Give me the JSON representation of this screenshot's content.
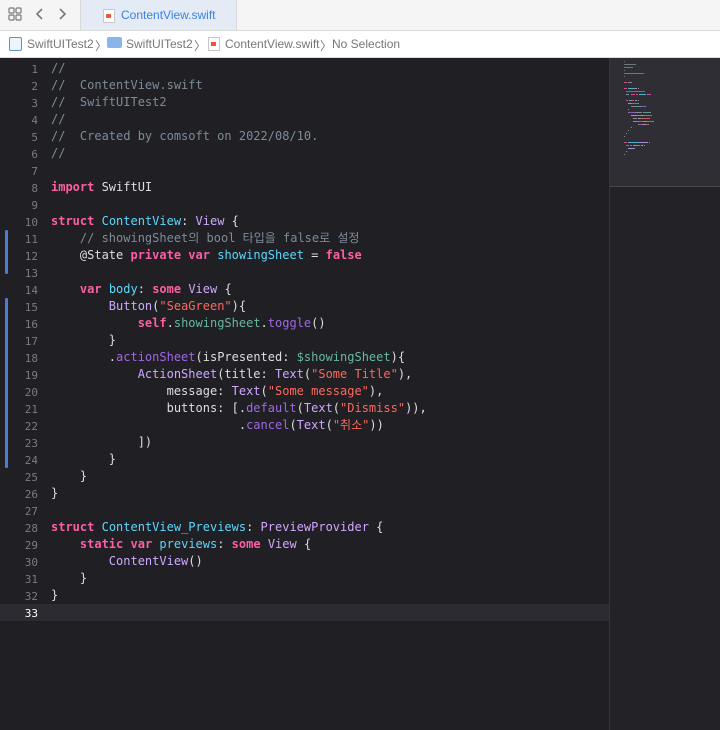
{
  "tabbar": {
    "active_tab": "ContentView.swift",
    "grid_icon": "grid-icon",
    "back_icon": "chevron-left-icon",
    "forward_icon": "chevron-right-icon"
  },
  "jumpbar": {
    "project": "SwiftUITest2",
    "group": "SwiftUITest2",
    "file": "ContentView.swift",
    "selection": "No Selection"
  },
  "colors": {
    "keyword": "#fc5fa3",
    "string": "#fc6a5d",
    "comment": "#7e8c98",
    "type": "#d0a8ff",
    "declaration": "#5dd8ff",
    "function": "#a167e6",
    "change_bar": "#4b7bd4"
  },
  "editor": {
    "current_line": 33,
    "lines": [
      [
        {
          "t": "//",
          "c": "cmt"
        }
      ],
      [
        {
          "t": "//  ContentView.swift",
          "c": "cmt"
        }
      ],
      [
        {
          "t": "//  SwiftUITest2",
          "c": "cmt"
        }
      ],
      [
        {
          "t": "//",
          "c": "cmt"
        }
      ],
      [
        {
          "t": "//  Created by comsoft on 2022/08/10.",
          "c": "cmt"
        }
      ],
      [
        {
          "t": "//",
          "c": "cmt"
        }
      ],
      [],
      [
        {
          "t": "import",
          "c": "kw"
        },
        {
          "t": " SwiftUI",
          "c": "plain"
        }
      ],
      [],
      [
        {
          "t": "struct",
          "c": "kw"
        },
        {
          "t": " ",
          "c": "plain"
        },
        {
          "t": "ContentView",
          "c": "decl"
        },
        {
          "t": ": ",
          "c": "plain"
        },
        {
          "t": "View",
          "c": "typ"
        },
        {
          "t": " {",
          "c": "plain"
        }
      ],
      [
        {
          "t": "    // showingSheet의 bool 타입을 false로 설정",
          "c": "cmt"
        }
      ],
      [
        {
          "t": "    @State",
          "c": "plain"
        },
        {
          "t": " ",
          "c": "plain"
        },
        {
          "t": "private",
          "c": "kw"
        },
        {
          "t": " ",
          "c": "plain"
        },
        {
          "t": "var",
          "c": "kw"
        },
        {
          "t": " ",
          "c": "plain"
        },
        {
          "t": "showingSheet",
          "c": "decl"
        },
        {
          "t": " = ",
          "c": "plain"
        },
        {
          "t": "false",
          "c": "kw"
        }
      ],
      [],
      [
        {
          "t": "    ",
          "c": "plain"
        },
        {
          "t": "var",
          "c": "kw"
        },
        {
          "t": " ",
          "c": "plain"
        },
        {
          "t": "body",
          "c": "decl"
        },
        {
          "t": ": ",
          "c": "plain"
        },
        {
          "t": "some",
          "c": "kw"
        },
        {
          "t": " ",
          "c": "plain"
        },
        {
          "t": "View",
          "c": "typ"
        },
        {
          "t": " {",
          "c": "plain"
        }
      ],
      [
        {
          "t": "        ",
          "c": "plain"
        },
        {
          "t": "Button",
          "c": "typ"
        },
        {
          "t": "(",
          "c": "plain"
        },
        {
          "t": "\"SeaGreen\"",
          "c": "str"
        },
        {
          "t": "){",
          "c": "plain"
        }
      ],
      [
        {
          "t": "            ",
          "c": "plain"
        },
        {
          "t": "self",
          "c": "kw"
        },
        {
          "t": ".",
          "c": "plain"
        },
        {
          "t": "showingSheet",
          "c": "prop"
        },
        {
          "t": ".",
          "c": "plain"
        },
        {
          "t": "toggle",
          "c": "fn"
        },
        {
          "t": "()",
          "c": "plain"
        }
      ],
      [
        {
          "t": "        }",
          "c": "plain"
        }
      ],
      [
        {
          "t": "        .",
          "c": "plain"
        },
        {
          "t": "actionSheet",
          "c": "fn"
        },
        {
          "t": "(isPresented: ",
          "c": "plain"
        },
        {
          "t": "$showingSheet",
          "c": "prop"
        },
        {
          "t": "){",
          "c": "plain"
        }
      ],
      [
        {
          "t": "            ",
          "c": "plain"
        },
        {
          "t": "ActionSheet",
          "c": "typ"
        },
        {
          "t": "(title: ",
          "c": "plain"
        },
        {
          "t": "Text",
          "c": "typ"
        },
        {
          "t": "(",
          "c": "plain"
        },
        {
          "t": "\"Some Title\"",
          "c": "str"
        },
        {
          "t": "),",
          "c": "plain"
        }
      ],
      [
        {
          "t": "                message: ",
          "c": "plain"
        },
        {
          "t": "Text",
          "c": "typ"
        },
        {
          "t": "(",
          "c": "plain"
        },
        {
          "t": "\"Some message\"",
          "c": "str"
        },
        {
          "t": "),",
          "c": "plain"
        }
      ],
      [
        {
          "t": "                buttons: [.",
          "c": "plain"
        },
        {
          "t": "default",
          "c": "fn"
        },
        {
          "t": "(",
          "c": "plain"
        },
        {
          "t": "Text",
          "c": "typ"
        },
        {
          "t": "(",
          "c": "plain"
        },
        {
          "t": "\"Dismiss\"",
          "c": "str"
        },
        {
          "t": ")),",
          "c": "plain"
        }
      ],
      [
        {
          "t": "                          .",
          "c": "plain"
        },
        {
          "t": "cancel",
          "c": "fn"
        },
        {
          "t": "(",
          "c": "plain"
        },
        {
          "t": "Text",
          "c": "typ"
        },
        {
          "t": "(",
          "c": "plain"
        },
        {
          "t": "\"취소\"",
          "c": "str"
        },
        {
          "t": "))",
          "c": "plain"
        }
      ],
      [
        {
          "t": "            ])",
          "c": "plain"
        }
      ],
      [
        {
          "t": "        }",
          "c": "plain"
        }
      ],
      [
        {
          "t": "    }",
          "c": "plain"
        }
      ],
      [
        {
          "t": "}",
          "c": "plain"
        }
      ],
      [],
      [
        {
          "t": "struct",
          "c": "kw"
        },
        {
          "t": " ",
          "c": "plain"
        },
        {
          "t": "ContentView_Previews",
          "c": "decl"
        },
        {
          "t": ": ",
          "c": "plain"
        },
        {
          "t": "PreviewProvider",
          "c": "typ"
        },
        {
          "t": " {",
          "c": "plain"
        }
      ],
      [
        {
          "t": "    ",
          "c": "plain"
        },
        {
          "t": "static",
          "c": "kw"
        },
        {
          "t": " ",
          "c": "plain"
        },
        {
          "t": "var",
          "c": "kw"
        },
        {
          "t": " ",
          "c": "plain"
        },
        {
          "t": "previews",
          "c": "decl"
        },
        {
          "t": ": ",
          "c": "plain"
        },
        {
          "t": "some",
          "c": "kw"
        },
        {
          "t": " ",
          "c": "plain"
        },
        {
          "t": "View",
          "c": "typ"
        },
        {
          "t": " {",
          "c": "plain"
        }
      ],
      [
        {
          "t": "        ",
          "c": "plain"
        },
        {
          "t": "ContentView",
          "c": "typ"
        },
        {
          "t": "()",
          "c": "plain"
        }
      ],
      [
        {
          "t": "    }",
          "c": "plain"
        }
      ],
      [
        {
          "t": "}",
          "c": "plain"
        }
      ],
      []
    ]
  }
}
